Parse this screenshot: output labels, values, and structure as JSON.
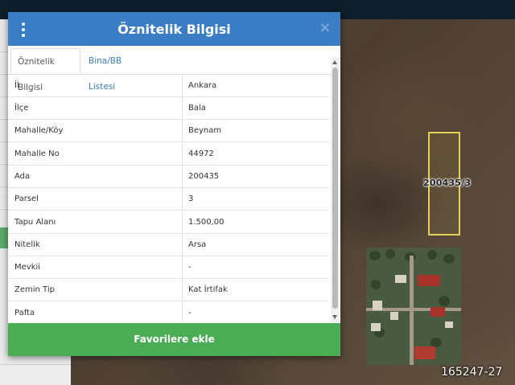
{
  "modal": {
    "title": "Öznitelik Bilgisi",
    "close_symbol": "×",
    "menu_icon": "vertical-dots-icon",
    "tabs": [
      {
        "label": "Öznitelik Bilgisi",
        "active": true
      },
      {
        "label": "Bina/BB Listesi",
        "active": false
      }
    ],
    "attributes": [
      {
        "key": "İl",
        "value": "Ankara"
      },
      {
        "key": "İlçe",
        "value": "Bala"
      },
      {
        "key": "Mahalle/Köy",
        "value": "Beynam"
      },
      {
        "key": "Mahalle No",
        "value": "44972"
      },
      {
        "key": "Ada",
        "value": "200435"
      },
      {
        "key": "Parsel",
        "value": "3"
      },
      {
        "key": "Tapu Alanı",
        "value": "1.500,00"
      },
      {
        "key": "Nitelik",
        "value": "Arsa"
      },
      {
        "key": "Mevkii",
        "value": "-"
      },
      {
        "key": "Zemin Tip",
        "value": "Kat İrtifak"
      },
      {
        "key": "Pafta",
        "value": "-"
      }
    ],
    "favorite_button": "Favorilere ekle"
  },
  "map": {
    "parcel_label": "200435/3",
    "watermark": "165247-27"
  },
  "colors": {
    "header": "#3b7dc4",
    "button": "#4aac54",
    "parcel_outline": "#e3d25a"
  }
}
